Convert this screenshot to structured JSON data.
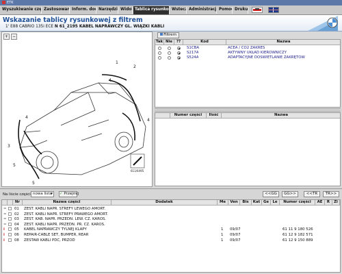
{
  "window": {
    "title": "ETK"
  },
  "menu": [
    "Wyszukiwanie części",
    "Zastosowanie",
    "Inform. dod.",
    "Narzędzia",
    "Widok",
    "Tablica rysunkowa",
    "Wstecz",
    "Administracja",
    "Pomoc",
    "Drukuj"
  ],
  "menu_active": "Tablica rysunkowa",
  "header": {
    "title": "Wskazanie tablicy rysunkowej z filtrem",
    "subtitle_prefix": "1' E88 CABRIO 135i ECE",
    "subtitle_code": "N 61_2195 KABEL NAPRAWCZY GL. WIĄZKI KABLI"
  },
  "drawing": {
    "code": "611/6495"
  },
  "filter": {
    "button_label": "Filtrem",
    "columns": [
      "Tak",
      "Nie",
      "??",
      "Kod",
      "Nazwa"
    ],
    "rows": [
      {
        "kod": "S1CBA",
        "nazwa": "ACEA / CO2 ZAKRES",
        "selected": "??"
      },
      {
        "kod": "S217A",
        "nazwa": "AKTYWNY UKŁAD KIEROWNICZY",
        "selected": "??"
      },
      {
        "kod": "S524A",
        "nazwa": "ADAPTACYJNE DOŚWIETLANIE ZAKRĘTÓW",
        "selected": "??"
      }
    ]
  },
  "parts_grid": {
    "columns": [
      "Numer części",
      "Ilość",
      "Nazwa"
    ]
  },
  "toolbar": {
    "list_label": "Na liście części",
    "list_value": "nowa lista",
    "accept_label": "Przejmij",
    "nav": [
      "<<GG",
      "GG>>",
      "<<TR",
      "TR>>"
    ]
  },
  "table": {
    "columns": [
      "Nr",
      "Nazwa części",
      "Dodatek",
      "Me",
      "Ven",
      "Bis",
      "Kat",
      "Ge",
      "Le",
      "Numer części",
      "AE",
      "R",
      "Zi"
    ],
    "rows": [
      {
        "mark": "=",
        "nr": "01",
        "name": "ZEST. KABLI NAPR. STREFY LEWEGO AMORT.",
        "me": "",
        "ven": "",
        "bis": "",
        "part": ""
      },
      {
        "mark": "=",
        "nr": "02",
        "name": "ZEST. KABLI NAPR. STREFY PRAWEGO AMORT.",
        "me": "",
        "ven": "",
        "bis": "",
        "part": ""
      },
      {
        "mark": "=",
        "nr": "03",
        "name": "ZEST. KAB. NAPR. PRZEDN. LEW. CZ. KAROS.",
        "me": "",
        "ven": "",
        "bis": "",
        "part": ""
      },
      {
        "mark": "=",
        "nr": "04",
        "name": "ZEST. KABLI NAPR. PRZEDN. PR. CZ. KAROS.",
        "me": "",
        "ven": "",
        "bis": "",
        "part": ""
      },
      {
        "mark": "i",
        "nr": "05",
        "name": "KABEL NAPRAWCZY TYLNEJ KLAPY",
        "me": "1",
        "ven": "09/07",
        "bis": "",
        "part": "61 11 9 180 526"
      },
      {
        "mark": "i",
        "nr": "06",
        "name": "REPAIR-CABLE SET, BUMPER, REAR",
        "me": "1",
        "ven": "09/07",
        "bis": "",
        "part": "61 12 9 182 571"
      },
      {
        "mark": "i",
        "nr": "08",
        "name": "ZESTAW KABLI PDC, PRZÓD",
        "me": "1",
        "ven": "09/07",
        "bis": "",
        "part": "61 12 9 150 889"
      }
    ]
  },
  "colors": {
    "accent": "#1f4f94",
    "menu_active_bg": "#2f2f2f",
    "info_mark": "#cc2222"
  }
}
